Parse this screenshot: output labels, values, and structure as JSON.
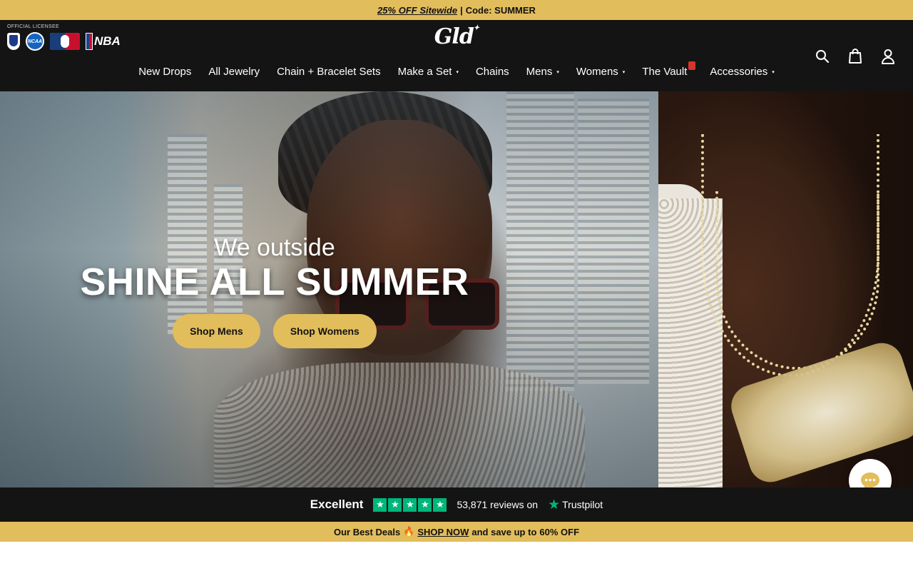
{
  "promo_top": {
    "highlight": "25% OFF Sitewide",
    "separator": "|",
    "code": "Code: SUMMER"
  },
  "header": {
    "licensee_label": "OFFICIAL LICENSEE",
    "league_logos": [
      "nfl-logo",
      "ncaa-logo",
      "mlb-logo",
      "nba-logo"
    ],
    "logo_texts": {
      "ncaa": "NCAA",
      "nba": "NBA"
    },
    "brand": "Gld",
    "icons": [
      "search-icon",
      "bag-icon",
      "account-icon"
    ]
  },
  "nav": {
    "items": [
      {
        "label": "New Drops"
      },
      {
        "label": "All Jewelry"
      },
      {
        "label": "Chain + Bracelet Sets"
      },
      {
        "label": "Make a Set",
        "caret": "▾"
      },
      {
        "label": "Chains"
      },
      {
        "label": "Mens",
        "caret": "▾"
      },
      {
        "label": "Womens",
        "caret": "▾"
      },
      {
        "label": "The Vault"
      },
      {
        "label": "Accessories",
        "caret": "▾"
      }
    ]
  },
  "hero": {
    "subtitle": "We outside",
    "title": "SHINE ALL SUMMER",
    "buttons": {
      "mens": "Shop Mens",
      "womens": "Shop Womens"
    }
  },
  "trustpilot": {
    "rating_label": "Excellent",
    "stars": 5,
    "star_glyph": "★",
    "reviews": "53,871 reviews on",
    "brand": "Trustpilot"
  },
  "promo_bottom": {
    "lead": "Our Best Deals",
    "fire": "🔥",
    "link": "SHOP NOW",
    "middle": "and save up to",
    "discount": "60% OFF"
  },
  "colors": {
    "accent_gold": "#e2bd5c",
    "header_bg": "#141414",
    "trustpilot_green": "#00b67a"
  }
}
